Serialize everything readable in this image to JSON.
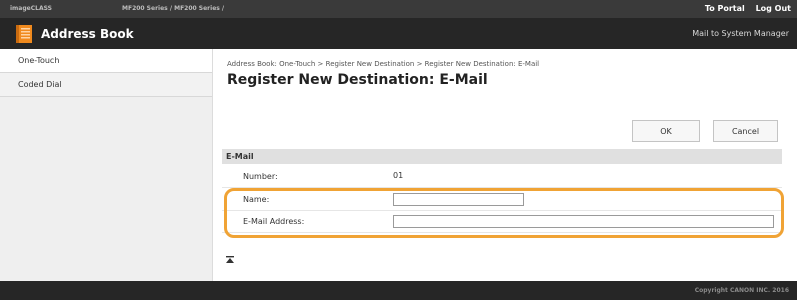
{
  "topbar": {
    "product": "imageCLASS",
    "model": "MF200 Series / MF200 Series /",
    "to_portal": "To Portal",
    "log_out": "Log Out"
  },
  "appbar": {
    "title": "Address Book",
    "mail_to_sysadmin": "Mail to System Manager"
  },
  "sidebar": {
    "items": [
      {
        "label": "One-Touch",
        "active": true
      },
      {
        "label": "Coded Dial",
        "active": false
      }
    ]
  },
  "main": {
    "breadcrumb": "Address Book: One-Touch > Register New Destination > Register New Destination: E-Mail",
    "page_title": "Register New Destination: E-Mail",
    "ok_label": "OK",
    "cancel_label": "Cancel",
    "section_title": "E-Mail",
    "fields": {
      "number_label": "Number:",
      "number_value": "01",
      "name_label": "Name:",
      "name_value": "",
      "email_label": "E-Mail Address:",
      "email_value": ""
    }
  },
  "footer": {
    "copyright": "Copyright CANON INC. 2016"
  },
  "colors": {
    "highlight": "#f0a335",
    "header_bg": "#262626",
    "topbar_bg": "#3a3a3a",
    "book_icon": "#f08a1e"
  },
  "icons": {
    "app_icon": "address-book-icon",
    "to_top": "to-top-icon"
  }
}
